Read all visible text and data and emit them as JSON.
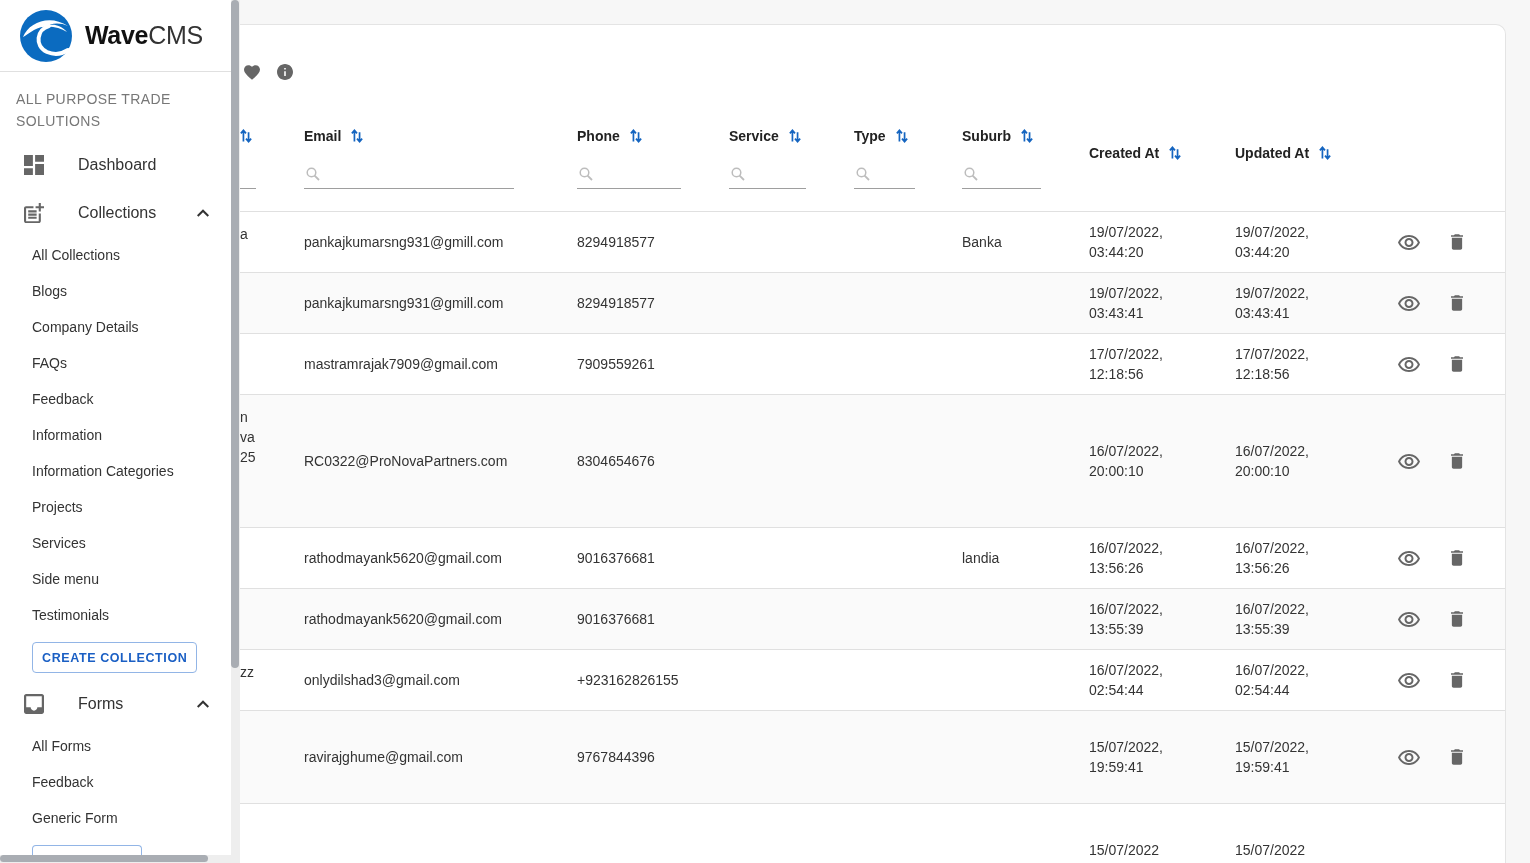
{
  "sidebar": {
    "logo_text": "**Wave**CMS",
    "company": "ALL PURPOSE TRADE SOLUTIONS",
    "nav": [
      {
        "kind": "link",
        "label": "Dashboard"
      },
      {
        "kind": "group",
        "label": "Collections",
        "expanded": true,
        "children": [
          "All Collections",
          "Blogs",
          "Company Details",
          "FAQs",
          "Feedback",
          "Information",
          "Information Categories",
          "Projects",
          "Services",
          "Side menu",
          "Testimonials"
        ],
        "action": {
          "label": "CREATE COLLECTION",
          "cut": false
        }
      },
      {
        "kind": "group",
        "label": "Forms",
        "expanded": true,
        "children": [
          "All Forms",
          "Feedback",
          "Generic Form"
        ],
        "action": {
          "cut": true
        }
      }
    ]
  },
  "table": {
    "columns": [
      {
        "sortable": true,
        "filterable": true
      },
      {
        "label": "Email",
        "sortable": true,
        "filterable": true
      },
      {
        "label": "Phone",
        "sortable": true,
        "filterable": true
      },
      {
        "label": "Service",
        "sortable": true,
        "filterable": true
      },
      {
        "label": "Type",
        "sortable": true,
        "filterable": true
      },
      {
        "label": "Suburb",
        "sortable": true,
        "filterable": true
      },
      {
        "label": "Created At",
        "sortable": true,
        "filterable": false
      },
      {
        "label": "Updated At",
        "sortable": true,
        "filterable": false
      }
    ],
    "rows": [
      {
        "column_1": [
          "a"
        ],
        "email": "pankajkumarsng931@gmill.com",
        "phone": "8294918577",
        "suburb": "Banka",
        "created_at": "19/07/2022, 03:44:20",
        "updated_at": "19/07/2022, 03:44:20"
      },
      {
        "email": "pankajkumarsng931@gmill.com",
        "phone": "8294918577",
        "created_at": "19/07/2022, 03:43:41",
        "updated_at": "19/07/2022, 03:43:41"
      },
      {
        "email": "mastramrajak7909@gmail.com",
        "phone": "7909559261",
        "created_at": "17/07/2022, 12:18:56",
        "updated_at": "17/07/2022, 12:18:56"
      },
      {
        "column_1": [
          "n",
          "va",
          "25"
        ],
        "email": "RC0322@ProNovaPartners.com",
        "phone": "8304654676",
        "created_at": "16/07/2022, 20:00:10",
        "updated_at": "16/07/2022, 20:00:10"
      },
      {
        "email": "rathodmayank5620@gmail.com",
        "phone": "9016376681",
        "suburb": "landia",
        "created_at": "16/07/2022, 13:56:26",
        "updated_at": "16/07/2022, 13:56:26"
      },
      {
        "email": "rathodmayank5620@gmail.com",
        "phone": "9016376681",
        "created_at": "16/07/2022, 13:55:39",
        "updated_at": "16/07/2022, 13:55:39"
      },
      {
        "column_1": [
          "zz"
        ],
        "email": "onlydilshad3@gmail.com",
        "phone": "+923162826155",
        "created_at": "16/07/2022, 02:54:44",
        "updated_at": "16/07/2022, 02:54:44"
      },
      {
        "email": "ravirajghume@gmail.com",
        "phone": "9767844396",
        "created_at": "15/07/2022, 19:59:41",
        "updated_at": "15/07/2022, 19:59:41"
      }
    ],
    "cut_row": {
      "created_at": "15/07/2022",
      "updated_at": "15/07/2022"
    }
  }
}
